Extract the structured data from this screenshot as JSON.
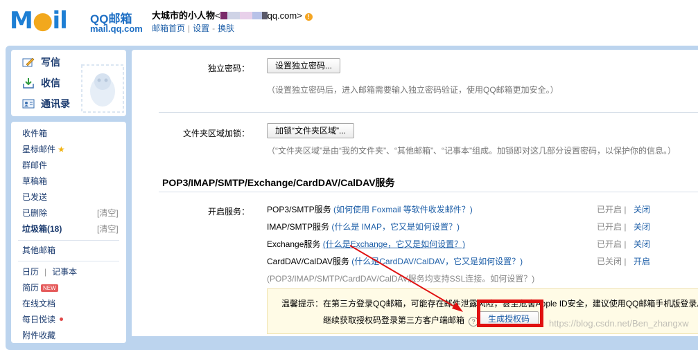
{
  "header": {
    "logo_qq": "QQ邮箱",
    "logo_url": "mail.qq.com",
    "user_name": "大城市的小人物",
    "email_prefix": "<",
    "email_suffix": "qq.com>",
    "links": [
      "邮箱首页",
      "设置",
      "换肤"
    ],
    "link_seps": [
      "|",
      "-"
    ]
  },
  "sidebar": {
    "quick": [
      "写信",
      "收信",
      "通讯录"
    ],
    "folders": [
      "收件箱",
      "星标邮件",
      "群邮件",
      "草稿箱",
      "已发送",
      "已删除",
      "垃圾箱(18)"
    ],
    "clear_label": "[清空]",
    "other": "其他邮箱",
    "calendar": "日历",
    "notebook": "记事本",
    "resume": "简历",
    "new_badge": "NEW",
    "online_docs": "在线文档",
    "daily": "每日悦读",
    "attachments": "附件收藏"
  },
  "main": {
    "pwd_label": "独立密码：",
    "pwd_button": "设置独立密码...",
    "pwd_hint": "（设置独立密码后，进入邮箱需要输入独立密码验证，使用QQ邮箱更加安全。）",
    "lock_label": "文件夹区域加锁：",
    "lock_button": "加锁“文件夹区域”...",
    "lock_hint": "（“文件夹区域”是由“我的文件夹”、“其他邮箱”、“记事本”组成。加锁即对这几部分设置密码，以保护你的信息。）",
    "section_title": "POP3/IMAP/SMTP/Exchange/CardDAV/CalDAV服务",
    "enable_label": "开启服务：",
    "services": [
      {
        "name": "POP3/SMTP服务",
        "link": "(如何使用 Foxmail 等软件收发邮件？)",
        "status": "已开启",
        "action": "关闭"
      },
      {
        "name": "IMAP/SMTP服务",
        "link": "(什么是 IMAP，它又是如何设置？)",
        "status": "已开启",
        "action": "关闭"
      },
      {
        "name": "Exchange服务",
        "link": "(什么是Exchange，它又是如何设置？)",
        "status": "已开启",
        "action": "关闭"
      },
      {
        "name": "CardDAV/CalDAV服务",
        "link": "(什么是CardDAV/CalDAV，它又是如何设置？)",
        "status": "已关闭",
        "action": "开启"
      }
    ],
    "ssl_note": "(POP3/IMAP/SMTP/CardDAV/CalDAV服务均支持SSL连接。如何设置？)",
    "status_sep": "|",
    "tip_line1": "温馨提示：在第三方登录QQ邮箱，可能存在邮件泄露风险，甚至危害Apple ID安全，建议使用QQ邮箱手机版登录。",
    "tip_line2": "继续获取授权码登录第三方客户端邮箱",
    "qmark": "?",
    "gen_button": "生成授权码"
  },
  "watermark": "https://blog.csdn.net/Ben_zhangxw",
  "colors": {
    "frame": "#bcd4ee",
    "link": "#1e5fa8",
    "annotation": "#e01010"
  }
}
